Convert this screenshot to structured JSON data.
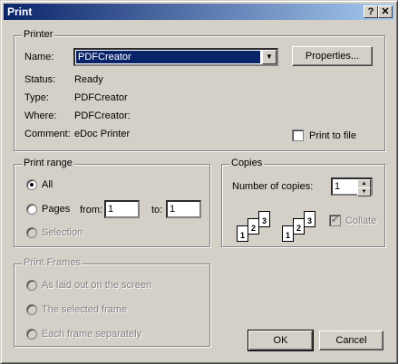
{
  "window": {
    "title": "Print",
    "help_label": "?",
    "close_label": "✕"
  },
  "printer": {
    "group_label": "Printer",
    "name_label": "Name:",
    "name_value": "PDFCreator",
    "properties_label": "Properties...",
    "status_label": "Status:",
    "status_value": "Ready",
    "type_label": "Type:",
    "type_value": "PDFCreator",
    "where_label": "Where:",
    "where_value": "PDFCreator:",
    "comment_label": "Comment:",
    "comment_value": "eDoc Printer",
    "print_to_file_label": "Print to file",
    "print_to_file_checked": false
  },
  "print_range": {
    "group_label": "Print range",
    "all_label": "All",
    "pages_label": "Pages",
    "from_label": "from:",
    "from_value": "1",
    "to_label": "to:",
    "to_value": "1",
    "selection_label": "Selection",
    "selected": "all"
  },
  "copies": {
    "group_label": "Copies",
    "number_label": "Number of copies:",
    "number_value": "1",
    "collate_label": "Collate",
    "collate_checked": true,
    "icon_labels": [
      "1",
      "2",
      "3"
    ]
  },
  "print_frames": {
    "group_label": "Print Frames",
    "options": [
      "As laid out on the screen",
      "The selected frame",
      "Each frame separately"
    ]
  },
  "buttons": {
    "ok_label": "OK",
    "cancel_label": "Cancel"
  },
  "colors": {
    "face": "#d4d0c8",
    "title_start": "#0a246a",
    "title_end": "#a6caf0",
    "selection": "#0a246a"
  }
}
